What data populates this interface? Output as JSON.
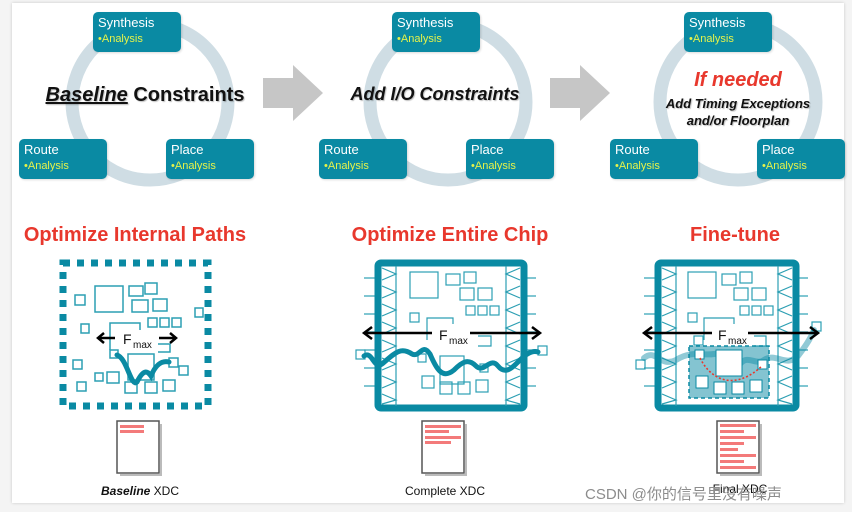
{
  "stages": [
    {
      "id": "baseline",
      "loop": [
        {
          "name": "Synthesis",
          "detail": "Analysis"
        },
        {
          "name": "Place",
          "detail": "Analysis"
        },
        {
          "name": "Route",
          "detail": "Analysis"
        }
      ],
      "center_emphasis": "Baseline",
      "center_rest": " Constraints",
      "goal": "Optimize Internal Paths",
      "diagram_label": "F",
      "diagram_sub": "max",
      "file_emphasis": "Baseline",
      "file_rest": " XDC"
    },
    {
      "id": "io",
      "loop": [
        {
          "name": "Synthesis",
          "detail": "Analysis"
        },
        {
          "name": "Place",
          "detail": "Analysis"
        },
        {
          "name": "Route",
          "detail": "Analysis"
        }
      ],
      "center_text": "Add I/O Constraints",
      "goal": "Optimize Entire Chip",
      "diagram_label": "F",
      "diagram_sub": "max",
      "file_label": "Complete XDC"
    },
    {
      "id": "finetune",
      "loop": [
        {
          "name": "Synthesis",
          "detail": "Analysis"
        },
        {
          "name": "Place",
          "detail": "Analysis"
        },
        {
          "name": "Route",
          "detail": "Analysis"
        }
      ],
      "center_highlight": "If needed",
      "center_line1": "Add Timing Exceptions",
      "center_line2": "and/or Floorplan",
      "goal": "Fine-tune",
      "diagram_label": "F",
      "diagram_sub": "max",
      "file_label": "Final XDC"
    }
  ],
  "bullet": "•",
  "watermark": "CSDN @你的信号里没有噪声",
  "colors": {
    "teal": "#0a8aa3",
    "analysis_yellow": "#e6f34a",
    "goal_red": "#e8382d",
    "loop_ring": "#cfdde4",
    "arrow_gray": "#c6c6c6",
    "xdc_line": "#f37a7a"
  }
}
